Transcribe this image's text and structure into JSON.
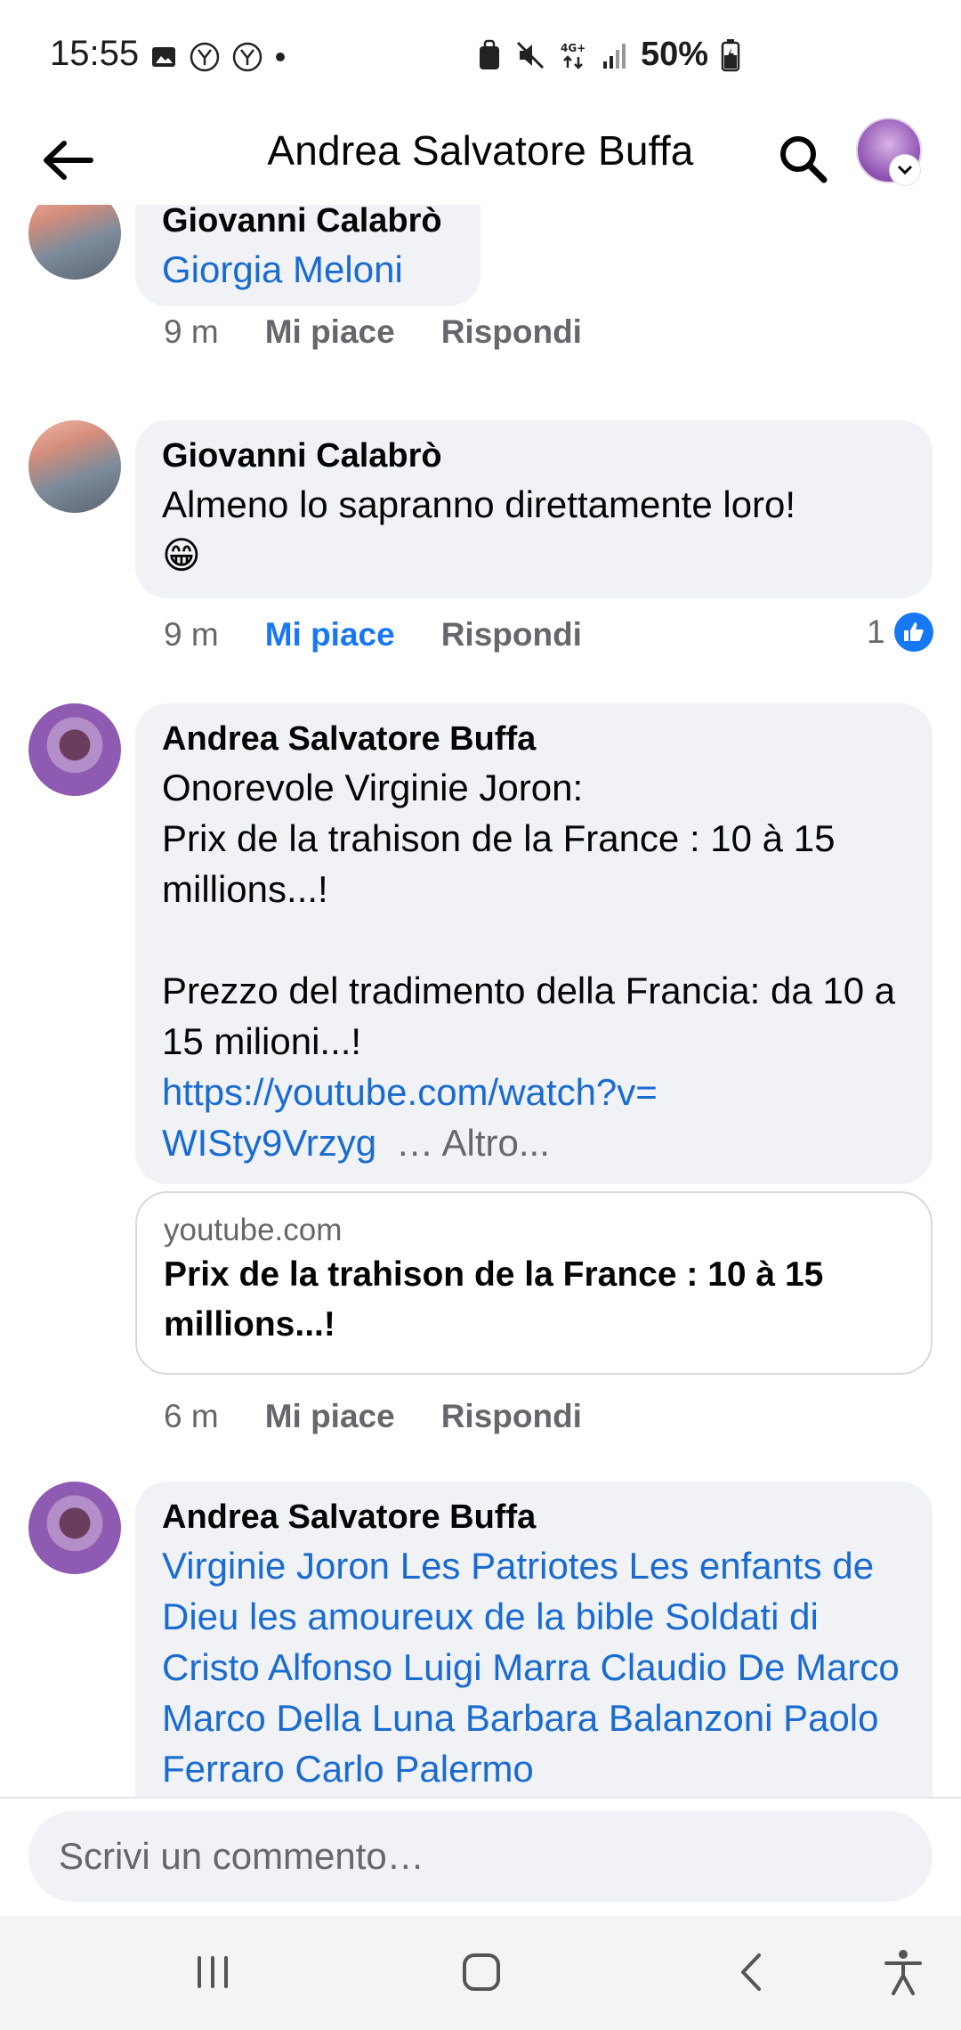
{
  "status_bar": {
    "time": "15:55",
    "battery": "50%"
  },
  "header": {
    "title": "Andrea Salvatore Buffa"
  },
  "comments": [
    {
      "author": "Giovanni Calabrò",
      "link_text": "Giorgia Meloni",
      "time": "9 m",
      "like_label": "Mi piace",
      "reply_label": "Rispondi"
    },
    {
      "author": "Giovanni Calabrò",
      "text": "Almeno lo sapranno direttamente loro!\n😁",
      "time": "9 m",
      "like_label": "Mi piace",
      "reply_label": "Rispondi",
      "reaction_count": "1"
    },
    {
      "author": "Andrea Salvatore Buffa",
      "text": "Onorevole Virginie Joron:\nPrix de la trahison de la France : 10 à 15 millions...!\n\nPrezzo del tradimento della Francia: da 10 a 15 milioni...!",
      "link": "https://youtube.com/watch?v=\nWISty9Vrzyg",
      "more": "… Altro...",
      "card_domain": "youtube.com",
      "card_title": "Prix de la trahison de la France : 10 à 15 millions...!",
      "time": "6 m",
      "like_label": "Mi piace",
      "reply_label": "Rispondi"
    },
    {
      "author": "Andrea Salvatore Buffa",
      "tags": "Virginie Joron Les Patriotes Les enfants de Dieu les amoureux de la bible Soldati di Cristo Alfonso Luigi Marra Claudio De Marco Marco Della Luna Barbara Balanzoni Paolo Ferraro Carlo Palermo"
    }
  ],
  "composer": {
    "placeholder": "Scrivi un commento…"
  }
}
